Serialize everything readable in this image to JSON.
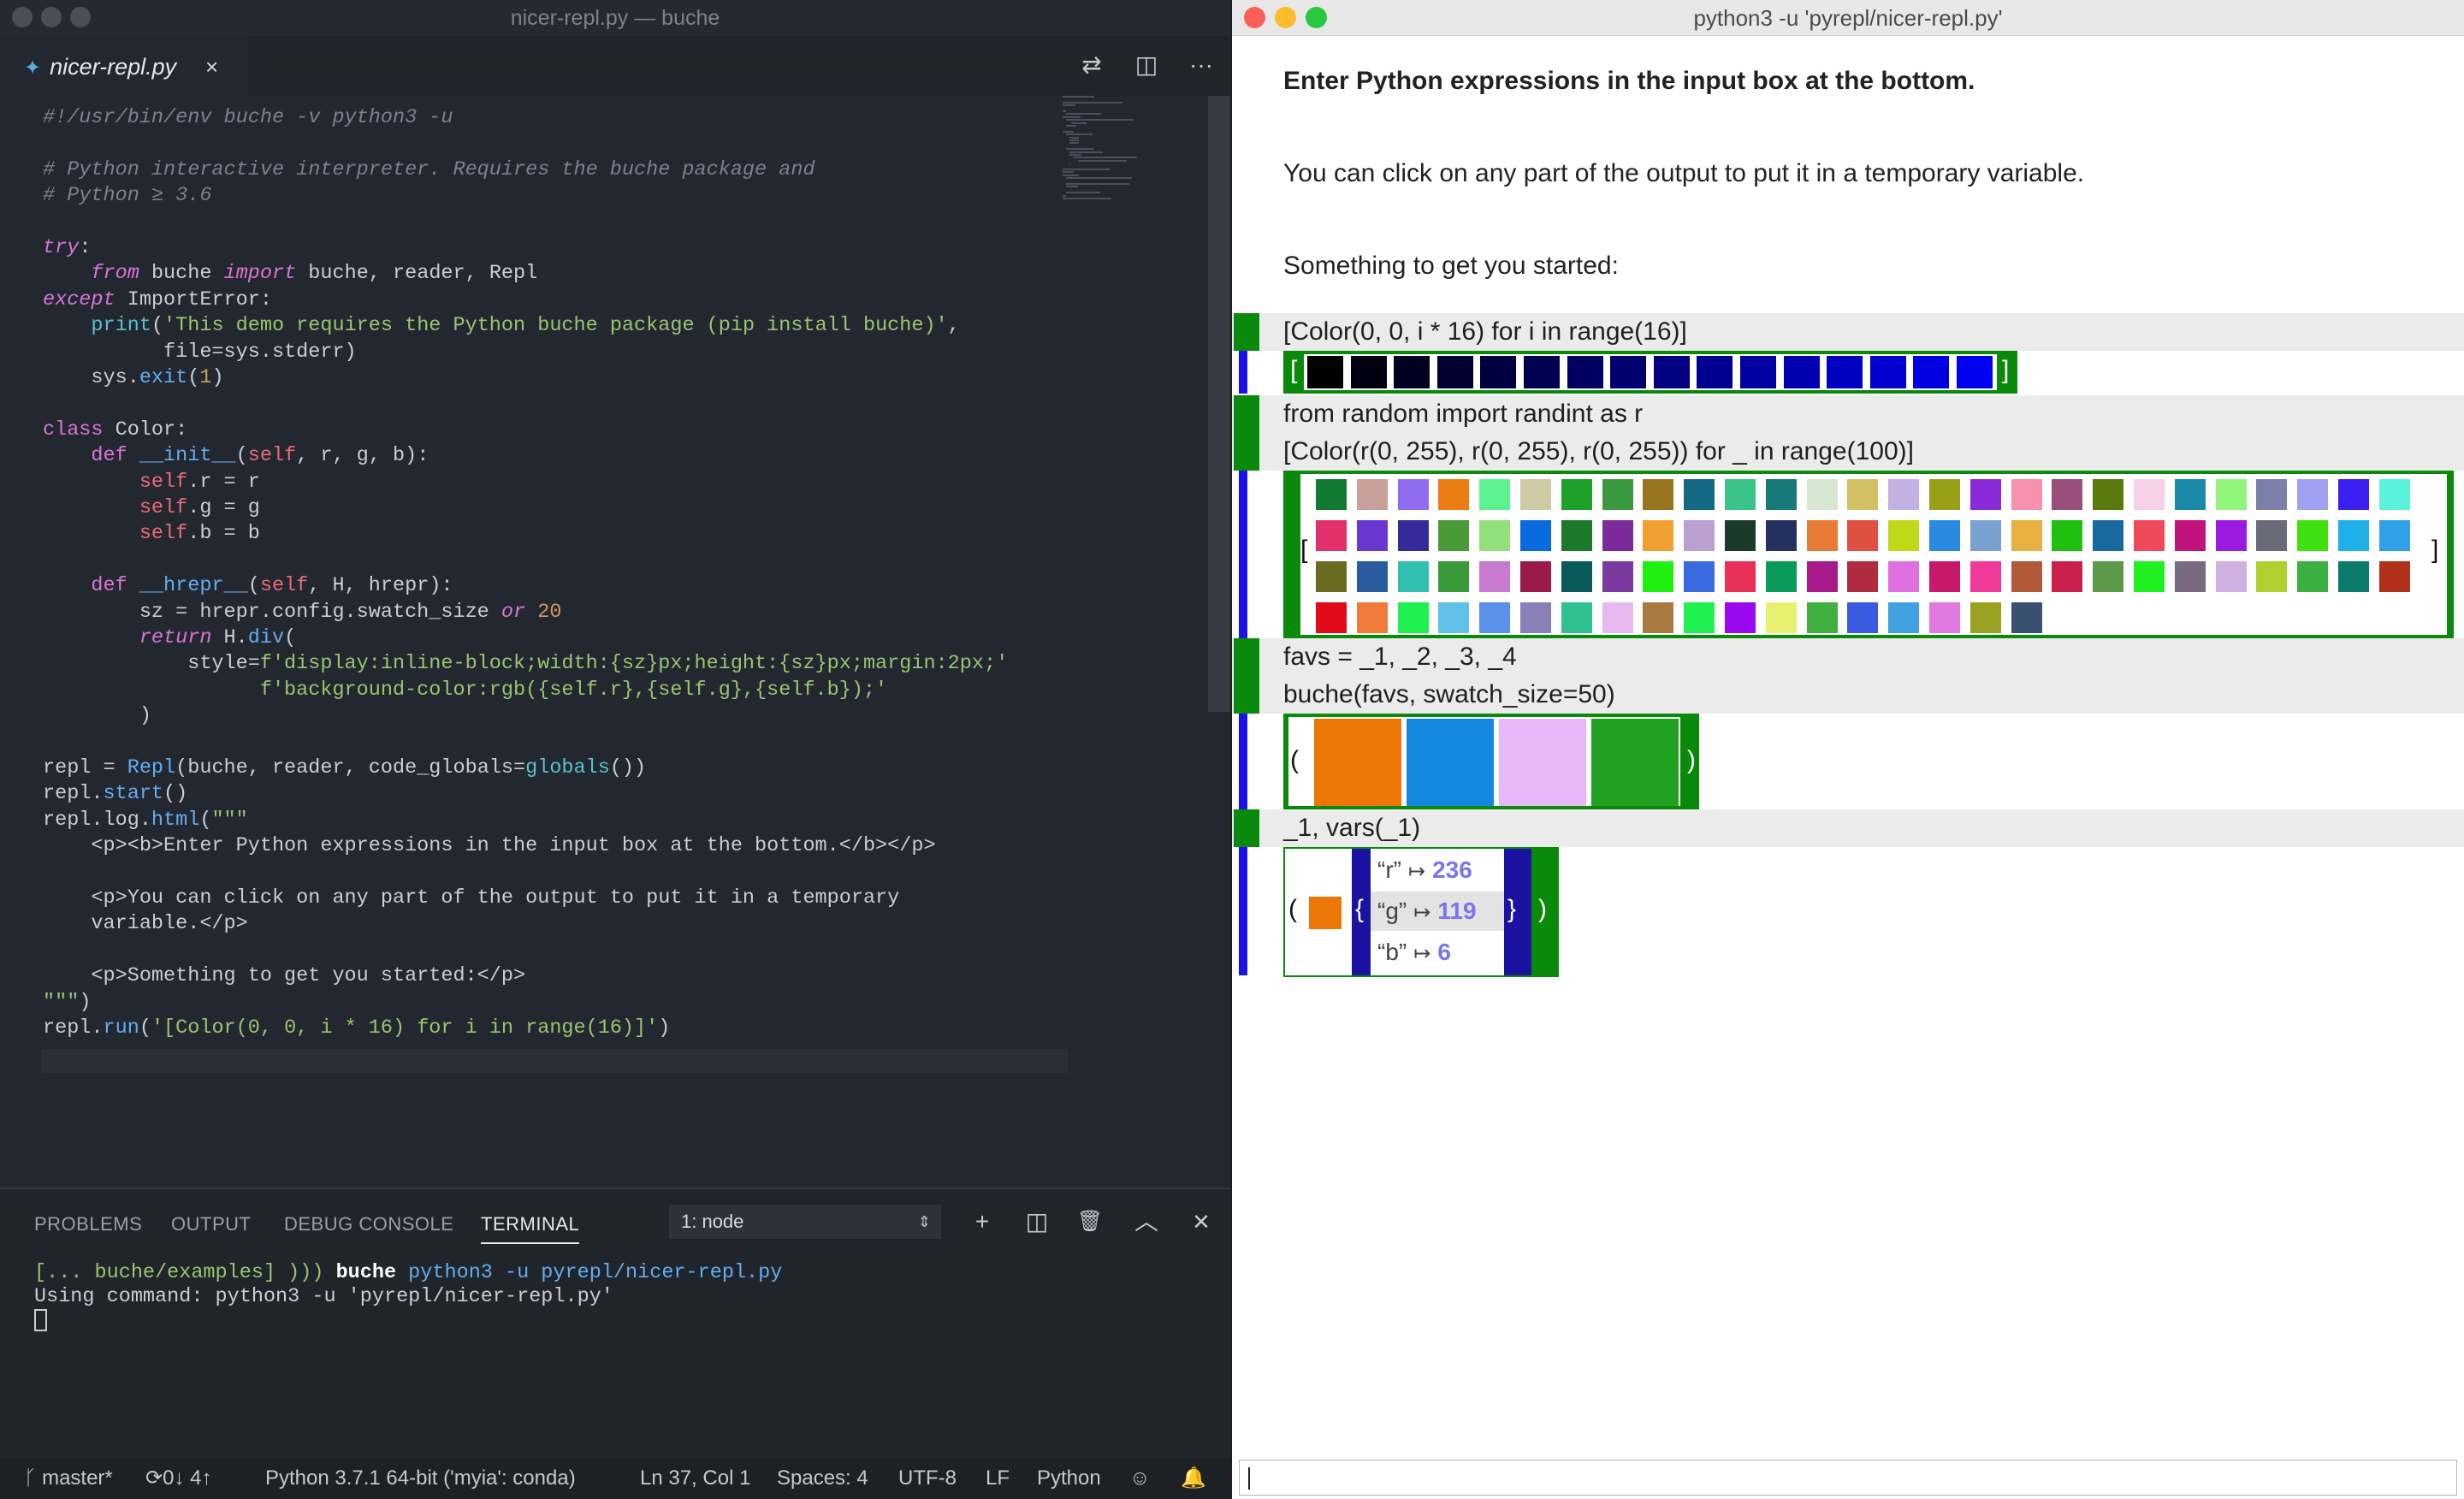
{
  "editor": {
    "window_title": "nicer-repl.py — buche",
    "tab": {
      "name": "nicer-repl.py",
      "close": "×"
    },
    "toolbar": {
      "compare": "⇄",
      "split": "◫",
      "more": "···"
    }
  },
  "code_lines": [
    "#!/usr/bin/env buche -v python3 -u",
    "",
    "# Python interactive interpreter. Requires the buche package and",
    "# Python ≥ 3.6",
    "",
    "try:",
    "    from buche import buche, reader, Repl",
    "except ImportError:",
    "    print('This demo requires the Python buche package (pip install buche)',",
    "          file=sys.stderr)",
    "    sys.exit(1)",
    "",
    "class Color:",
    "    def __init__(self, r, g, b):",
    "        self.r = r",
    "        self.g = g",
    "        self.b = b",
    "",
    "    def __hrepr__(self, H, hrepr):",
    "        sz = hrepr.config.swatch_size or 20",
    "        return H.div(",
    "            style=f'display:inline-block;width:{sz}px;height:{sz}px;margin:2px;'",
    "                  f'background-color:rgb({self.r},{self.g},{self.b});'",
    "        )",
    "",
    "repl = Repl(buche, reader, code_globals=globals())",
    "repl.start()",
    "repl.log.html(\"\"\"",
    "    <p><b>Enter Python expressions in the input box at the bottom.</b></p>",
    "",
    "    <p>You can click on any part of the output to put it in a temporary",
    "    variable.</p>",
    "",
    "    <p>Something to get you started:</p>",
    "\"\"\")",
    "repl.run('[Color(0, 0, i * 16) for i in range(16)]')"
  ],
  "panel": {
    "tabs": [
      "PROBLEMS",
      "OUTPUT",
      "DEBUG CONSOLE",
      "TERMINAL"
    ],
    "active_tab": "TERMINAL",
    "terminal_select": "1: node",
    "icons": {
      "add": "+",
      "split": "◫",
      "trash": "🗑",
      "maximize": "︿",
      "close": "✕"
    }
  },
  "terminal": {
    "prompt": "[... buche/examples] ))) ",
    "cmd": "buche",
    "args": " python3 -u pyrepl/nicer-repl.py",
    "line2": "Using command: python3 -u 'pyrepl/nicer-repl.py'"
  },
  "status": {
    "branch": "master*",
    "sync": "0↓ 4↑",
    "interpreter": "Python 3.7.1 64-bit ('myia': conda)",
    "position": "Ln 37, Col 1",
    "spaces": "Spaces: 4",
    "encoding": "UTF-8",
    "eol": "LF",
    "language": "Python"
  },
  "repl": {
    "window_title": "python3 -u 'pyrepl/nicer-repl.py'",
    "intro_bold": "Enter Python expressions in the input box at the bottom.",
    "intro_click": "You can click on any part of the output to put it in a temporary variable.",
    "intro_start": "Something to get you started:",
    "input1": "[Color(0, 0, i * 16) for i in range(16)]",
    "input2a": "from random import randint as r",
    "input2b": "[Color(r(0, 255), r(0, 255), r(0, 255)) for _ in range(100)]",
    "input3a": "favs = _1, _2, _3, _4",
    "input3b": "buche(favs, swatch_size=50)",
    "input4": "_1, vars(_1)",
    "bracket_open": "[",
    "bracket_close": "]",
    "paren_open": "(",
    "paren_close": ")",
    "brace_open": "{",
    "brace_close": "}",
    "dict_entries": [
      {
        "key": "“r”",
        "arrow": "↦",
        "value": "236"
      },
      {
        "key": "“g”",
        "arrow": "↦",
        "value": "119"
      },
      {
        "key": "“b”",
        "arrow": "↦",
        "value": "6"
      }
    ],
    "blues": [
      "#000000",
      "#000010",
      "#000020",
      "#000030",
      "#000040",
      "#000050",
      "#000060",
      "#000070",
      "#000080",
      "#000090",
      "#0000a0",
      "#0000b0",
      "#0000c0",
      "#0000d0",
      "#0000e0",
      "#0000f0"
    ],
    "palette": [
      "#0f7a30",
      "#c9a09a",
      "#8f6cf0",
      "#ec7c14",
      "#5cf28f",
      "#cfc9a5",
      "#1ea12a",
      "#3b9a40",
      "#9a7520",
      "#146a82",
      "#3ac48a",
      "#177a78",
      "#d6e6d0",
      "#d1c064",
      "#c4b0e2",
      "#98a018",
      "#8a2ad9",
      "#f890b0",
      "#9a4f7a",
      "#5a7a10",
      "#f6d0e6",
      "#1a8aa8",
      "#90f57a",
      "#7a80a8",
      "#a0a0f0",
      "#3a20f0",
      "#5af2da",
      "#e1306a",
      "#6a38d0",
      "#342a9a",
      "#4a9a3a",
      "#92e07a",
      "#0a6ae0",
      "#1a7a2a",
      "#7a2a9a",
      "#f0a030",
      "#b9a0d0",
      "#1a3a2a",
      "#243060",
      "#e87a38",
      "#e05040",
      "#c0d818",
      "#2a8ae0",
      "#7aa0d0",
      "#e8b040",
      "#20c010",
      "#1a6aa0",
      "#f04a5a",
      "#c0147a",
      "#9a1ae0",
      "#6a6a78",
      "#40e010",
      "#20b0e8",
      "#30a0e8",
      "#6a6a20",
      "#2a5aa0",
      "#30c0b0",
      "#3a9a3a",
      "#c87ad0",
      "#9a1a4a",
      "#0a5a5a",
      "#7a3aa0",
      "#20f010",
      "#3a6ae0",
      "#e83058",
      "#0a9a5a",
      "#a81a8a",
      "#b02a40",
      "#e070e0",
      "#c8186a",
      "#f03a9a",
      "#b05a3a",
      "#c8204a",
      "#5a9a4a",
      "#20f020",
      "#7a6a80",
      "#d0b0e0",
      "#b0d030",
      "#3ab040",
      "#0a7a6a",
      "#b0301a",
      "#e00a1a",
      "#f07a3a",
      "#20f050",
      "#60c0e8",
      "#5a90e8",
      "#8a80b8",
      "#30c090",
      "#e8b8f0",
      "#a87a40",
      "#20f050",
      "#9a0af0",
      "#e8f070",
      "#40b040",
      "#3a5ae0",
      "#40a0e0",
      "#e07ae0",
      "#9aa020",
      "#3a5070"
    ],
    "favs": [
      "#ec7706",
      "#1488e0",
      "#e8b8f8",
      "#22a220"
    ],
    "swatch_color": "#ec7706"
  }
}
